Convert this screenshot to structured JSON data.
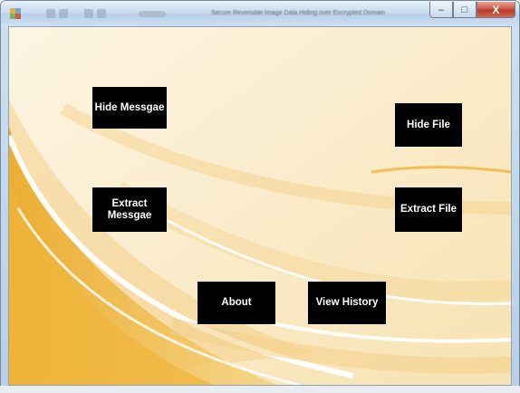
{
  "window": {
    "title": "Secure Reversible Image Data Hiding over Encrypted Domain",
    "controls": {
      "minimize": "–",
      "maximize": "□",
      "close": "X"
    }
  },
  "buttons": {
    "hide_message": "Hide Messgae",
    "extract_message_line1": "Extract",
    "extract_message_line2": "Messgae",
    "hide_file": "Hide File",
    "extract_file": "Extract File",
    "about": "About",
    "view_history": "View History"
  },
  "colors": {
    "background": "#fbf0d8",
    "accent_gold": "#f0b93a",
    "button_bg": "#000000",
    "button_text": "#ffffff"
  }
}
